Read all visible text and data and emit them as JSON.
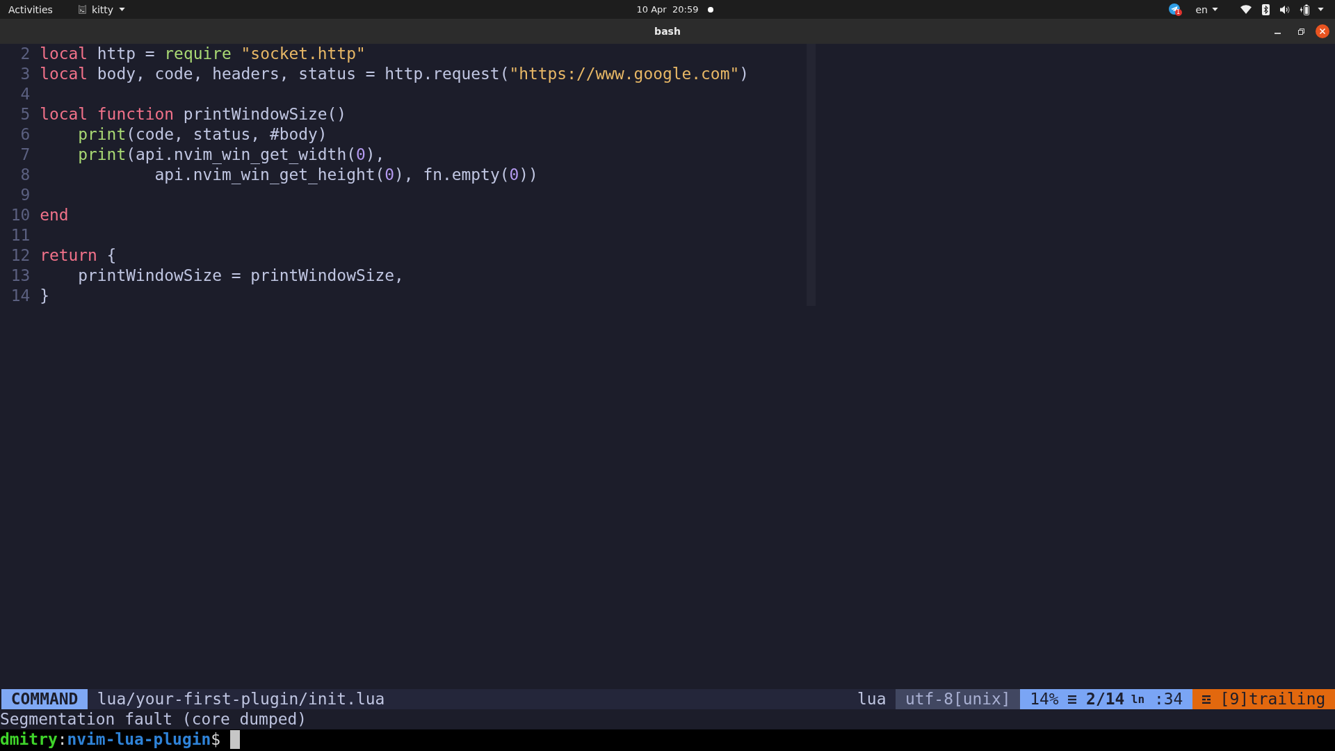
{
  "top_bar": {
    "activities": "Activities",
    "app_menu": "kitty",
    "clock": "10 Apr  20:59",
    "tray": {
      "badge": "1",
      "language": "en"
    }
  },
  "window": {
    "title": "bash"
  },
  "editor": {
    "lines": [
      {
        "number": "2",
        "tokens": [
          {
            "kind": "keyword",
            "text": "local"
          },
          {
            "kind": "plain",
            "text": " http = "
          },
          {
            "kind": "builtin",
            "text": "require "
          },
          {
            "kind": "string",
            "text": "\"socket.http\""
          }
        ]
      },
      {
        "number": "3",
        "tokens": [
          {
            "kind": "keyword",
            "text": "local"
          },
          {
            "kind": "plain",
            "text": " body, code, headers, status = http.request("
          },
          {
            "kind": "string",
            "text": "\"https://www.google.com\""
          },
          {
            "kind": "plain",
            "text": ")"
          }
        ]
      },
      {
        "number": "4"
      },
      {
        "number": "5",
        "tokens": [
          {
            "kind": "keyword",
            "text": "local function"
          },
          {
            "kind": "plain",
            "text": " printWindowSize()"
          }
        ]
      },
      {
        "number": "6",
        "tokens": [
          {
            "kind": "builtin",
            "text": "    print"
          },
          {
            "kind": "plain",
            "text": "(code, status, #body)"
          }
        ]
      },
      {
        "number": "7",
        "tokens": [
          {
            "kind": "builtin",
            "text": "    print"
          },
          {
            "kind": "plain",
            "text": "(api.nvim_win_get_width("
          },
          {
            "kind": "number",
            "text": "0"
          },
          {
            "kind": "plain",
            "text": "),"
          }
        ]
      },
      {
        "number": "8",
        "tokens": [
          {
            "kind": "plain",
            "text": "            api.nvim_win_get_height("
          },
          {
            "kind": "number",
            "text": "0"
          },
          {
            "kind": "plain",
            "text": "), fn.empty("
          },
          {
            "kind": "number",
            "text": "0"
          },
          {
            "kind": "plain",
            "text": "))"
          }
        ]
      },
      {
        "number": "9"
      },
      {
        "number": "10",
        "tokens": [
          {
            "kind": "keyword",
            "text": "end"
          }
        ]
      },
      {
        "number": "11"
      },
      {
        "number": "12",
        "tokens": [
          {
            "kind": "keyword",
            "text": "return"
          },
          {
            "kind": "plain",
            "text": " {"
          }
        ]
      },
      {
        "number": "13",
        "tokens": [
          {
            "kind": "plain",
            "text": "    printWindowSize = printWindowSize,"
          }
        ]
      },
      {
        "number": "14",
        "tokens": [
          {
            "kind": "plain",
            "text": "}"
          }
        ]
      }
    ]
  },
  "status_line": {
    "mode": "COMMAND",
    "file_path": "lua/your-first-plugin/init.lua",
    "filetype": "lua",
    "encoding": "utf-8[unix]",
    "percent": "14%",
    "line": "2/14",
    "column_symbol": "ln",
    "column": ":34",
    "trailing": "[9]trailing"
  },
  "message": "Segmentation fault (core dumped)",
  "prompt": {
    "user": "dmitry",
    "separator": ":",
    "directory": "nvim-lua-plugin",
    "symbol": "$"
  }
}
